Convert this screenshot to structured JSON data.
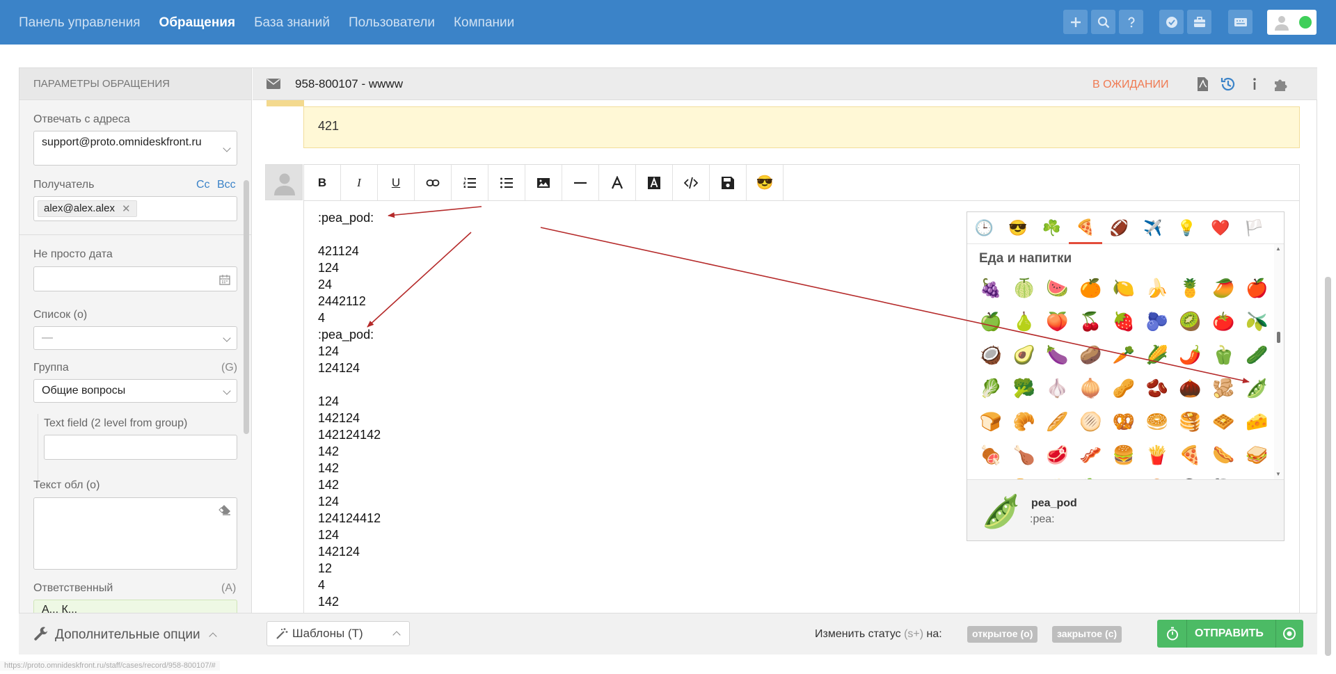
{
  "nav": {
    "items": [
      "Панель управления",
      "Обращения",
      "База знаний",
      "Пользователи",
      "Компании"
    ],
    "active_index": 1
  },
  "topbar_icons": [
    "plus-icon",
    "search-icon",
    "help-icon",
    "check-badge-icon",
    "briefcase-icon",
    "keyboard-icon"
  ],
  "sidebar": {
    "header": "ПАРАМЕТРЫ ОБРАЩЕНИЯ",
    "reply_from_label": "Отвечать с адреса",
    "reply_from_value": "support@proto.omnideskfront.ru",
    "recipient_label": "Получатель",
    "cc": "Cc",
    "bcc": "Bcc",
    "recipient_tag": "alex@alex.alex",
    "date_label": "Не просто дата",
    "list_label": "Список (o)",
    "list_value": "—",
    "group_label": "Группа",
    "group_hotkey": "(G)",
    "group_value": "Общие вопросы",
    "text_field_label": "Text field (2 level from group)",
    "textarea_label": "Текст обл (o)",
    "assignee_label": "Ответственный",
    "assignee_hotkey": "(A)",
    "assignee_value": "А... К..."
  },
  "case": {
    "title": "958-800107 - wwww",
    "status": "В ОЖИДАНИИ",
    "note_text": "421"
  },
  "editor": {
    "toolbar": [
      "B",
      "I",
      "U",
      "link",
      "ordered-list",
      "bullet-list",
      "image",
      "hr",
      "font-color",
      "bg-color",
      "code",
      "save",
      "emoji"
    ],
    "lines": [
      ":pea_pod:",
      "",
      "421124",
      "124",
      "24",
      "2442112",
      "4",
      ":pea_pod:",
      "124",
      "124124",
      "",
      "124",
      "142124",
      "142124142",
      "142",
      "142",
      "142",
      "124",
      "124124412",
      "124",
      "142124",
      "12",
      "4",
      "142"
    ]
  },
  "emoji_picker": {
    "categories": [
      "🕒",
      "😎",
      "☘️",
      "🍕",
      "🏈",
      "✈️",
      "💡",
      "❤️",
      "🏳️"
    ],
    "selected_category": 3,
    "category_title": "Еда и напитки",
    "rows": [
      [
        "🍇",
        "🍈",
        "🍉",
        "🍊",
        "🍋",
        "🍌",
        "🍍",
        "🥭",
        "🍎"
      ],
      [
        "🍏",
        "🍐",
        "🍑",
        "🍒",
        "🍓",
        "🫐",
        "🥝",
        "🍅",
        "🫒"
      ],
      [
        "🥥",
        "🥑",
        "🍆",
        "🥔",
        "🥕",
        "🌽",
        "🌶️",
        "🫑",
        "🥒"
      ],
      [
        "🥬",
        "🥦",
        "🧄",
        "🧅",
        "🥜",
        "🫘",
        "🌰",
        "🫚",
        "🫛"
      ],
      [
        "🍞",
        "🥐",
        "🥖",
        "🫓",
        "🥨",
        "🥯",
        "🥞",
        "🧇",
        "🧀"
      ],
      [
        "🍖",
        "🍗",
        "🥩",
        "🥓",
        "🍔",
        "🍟",
        "🍕",
        "🌭",
        "🥪"
      ],
      [
        "🌮",
        "🌯",
        "🫔",
        "🥙",
        "🧆",
        "🥚",
        "🍳",
        "🥘",
        "🍲"
      ]
    ],
    "preview_emoji": "🫛",
    "preview_name": "pea_pod",
    "preview_code": ":pea:"
  },
  "footer": {
    "options": "Дополнительные опции",
    "templates": "Шаблоны (T)",
    "status_prefix": "Изменить статус",
    "status_hotkey": "(s+)",
    "status_suffix": "на:",
    "open": "открытое (o)",
    "closed": "закрытое (c)",
    "send": "ОТПРАВИТЬ"
  },
  "status_url": "https://proto.omnideskfront.ru/staff/cases/record/958-800107/#",
  "colors": {
    "topbar": "#3b83c8",
    "status": "#f07a52",
    "send": "#4cbb65",
    "arrow": "#b52a2a"
  }
}
